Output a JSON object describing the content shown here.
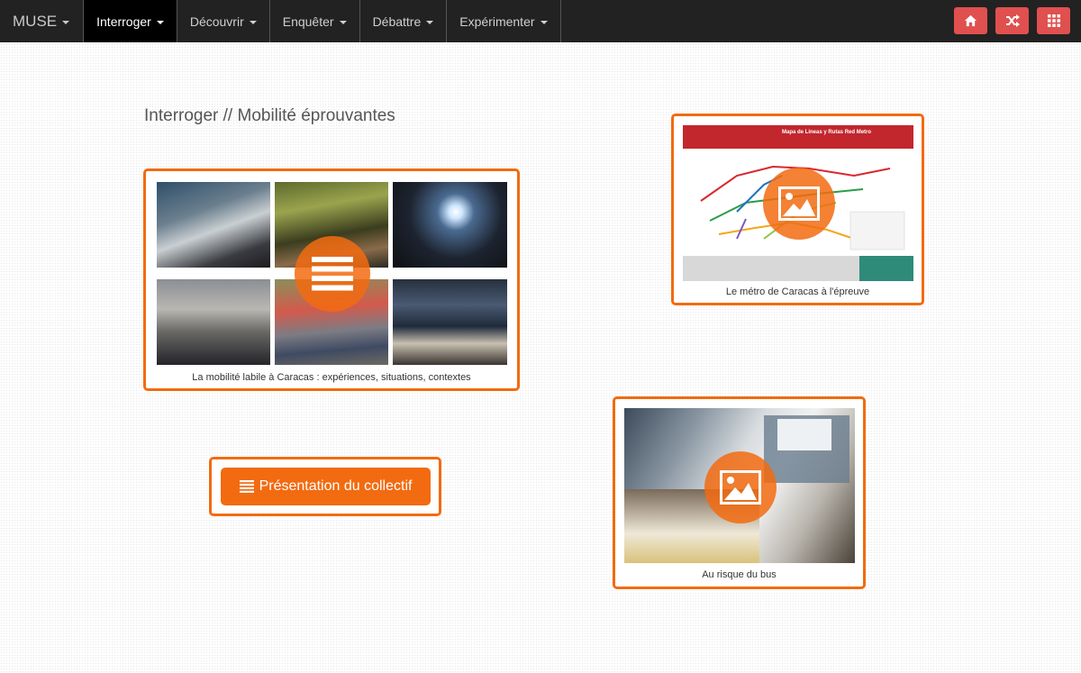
{
  "navbar": {
    "brand": "MUSE",
    "items": [
      {
        "label": "Interroger",
        "active": true
      },
      {
        "label": "Découvrir",
        "active": false
      },
      {
        "label": "Enquêter",
        "active": false
      },
      {
        "label": "Débattre",
        "active": false
      },
      {
        "label": "Expérimenter",
        "active": false
      }
    ],
    "right_buttons": [
      "home-icon",
      "shuffle-icon",
      "grid-icon"
    ],
    "accent_color": "#e0504f"
  },
  "page": {
    "title": "Interroger // Mobilité éprouvantes"
  },
  "cards": {
    "collage": {
      "caption": "La mobilité labile à Caracas : expériences, situations, contextes",
      "icon": "list-icon"
    },
    "metro": {
      "caption": "Le métro de Caracas à l'épreuve",
      "icon": "image-icon",
      "map_header": "Mapa de Lineas y Rutas Red Metro"
    },
    "bus": {
      "caption": "Au risque du bus",
      "icon": "image-icon"
    }
  },
  "presentation_button": {
    "label": "Présentation du collectif",
    "icon": "list-icon"
  },
  "colors": {
    "navbar_bg": "#222222",
    "accent_orange": "#f26b10"
  }
}
